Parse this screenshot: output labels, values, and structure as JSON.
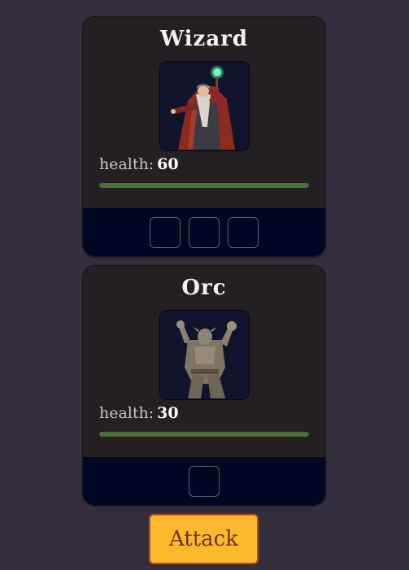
{
  "characters": [
    {
      "name": "Wizard",
      "health_label": "health:",
      "health": "60",
      "health_fraction": 1.0,
      "dice_slots": 3,
      "portrait": "wizard-portrait"
    },
    {
      "name": "Orc",
      "health_label": "health:",
      "health": "30",
      "health_fraction": 1.0,
      "dice_slots": 1,
      "portrait": "orc-portrait"
    }
  ],
  "attack_button": {
    "label": "Attack"
  },
  "colors": {
    "background": "#342d3b",
    "card": "#241f22",
    "card_footer": "#000722",
    "health_fill": "#4c7038",
    "button": "#fdb92c",
    "button_border": "#b84f12",
    "button_text": "#6b3412"
  }
}
